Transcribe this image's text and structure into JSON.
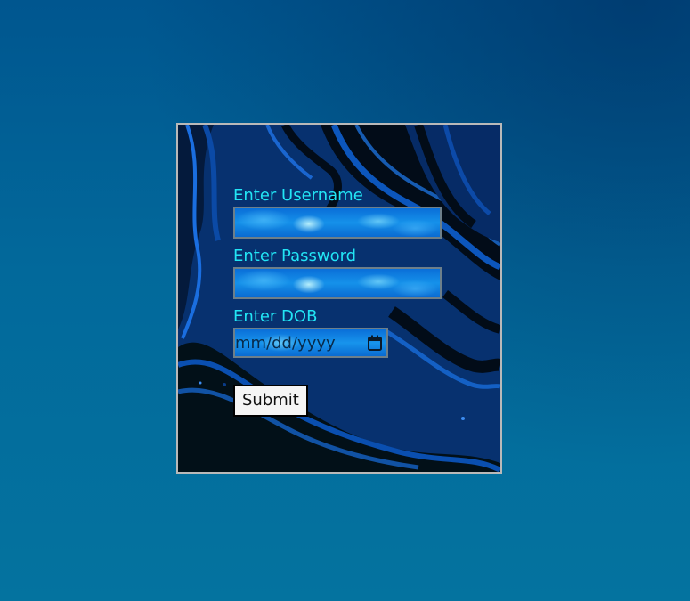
{
  "form": {
    "username_label": "Enter Username",
    "username_value": "",
    "password_label": "Enter Password",
    "password_value": "",
    "dob_label": "Enter DOB",
    "dob_placeholder": "mm/dd/yyyy",
    "submit_label": "Submit"
  },
  "icons": {
    "calendar": "calendar-icon"
  },
  "colors": {
    "label_text": "#22e5f5",
    "page_background": "#03679a",
    "input_fill": "#1591ea",
    "card_border": "#b9b9b9"
  }
}
